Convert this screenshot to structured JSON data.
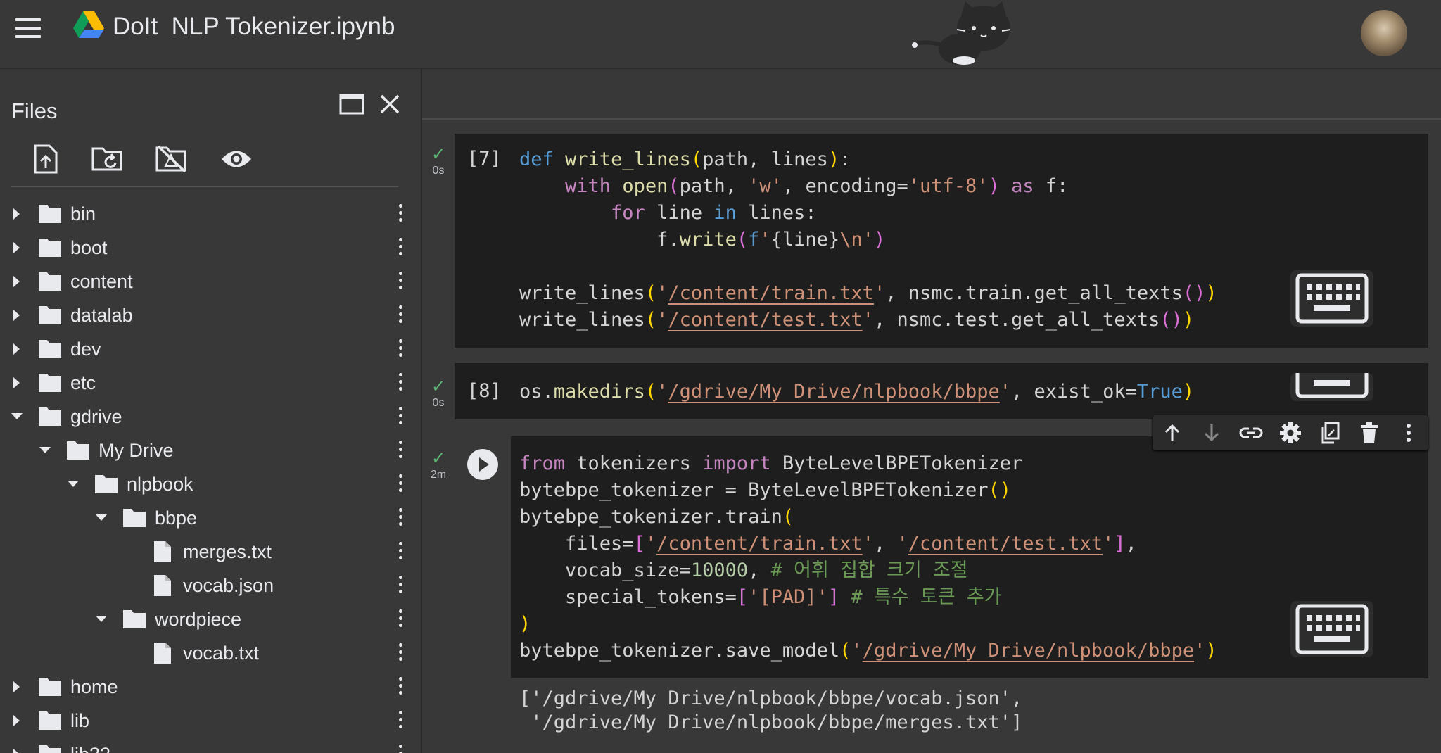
{
  "header": {
    "title": "DoIt  NLP Tokenizer.ipynb"
  },
  "sidebar": {
    "title": "Files",
    "items": [
      {
        "label": "bin",
        "type": "folder",
        "depth": 0,
        "expanded": false
      },
      {
        "label": "boot",
        "type": "folder",
        "depth": 0,
        "expanded": false
      },
      {
        "label": "content",
        "type": "folder",
        "depth": 0,
        "expanded": false
      },
      {
        "label": "datalab",
        "type": "folder",
        "depth": 0,
        "expanded": false
      },
      {
        "label": "dev",
        "type": "folder",
        "depth": 0,
        "expanded": false
      },
      {
        "label": "etc",
        "type": "folder",
        "depth": 0,
        "expanded": false
      },
      {
        "label": "gdrive",
        "type": "folder",
        "depth": 0,
        "expanded": true
      },
      {
        "label": "My Drive",
        "type": "folder",
        "depth": 1,
        "expanded": true
      },
      {
        "label": "nlpbook",
        "type": "folder",
        "depth": 2,
        "expanded": true
      },
      {
        "label": "bbpe",
        "type": "folder",
        "depth": 3,
        "expanded": true
      },
      {
        "label": "merges.txt",
        "type": "file",
        "depth": 4
      },
      {
        "label": "vocab.json",
        "type": "file",
        "depth": 4
      },
      {
        "label": "wordpiece",
        "type": "folder",
        "depth": 3,
        "expanded": true
      },
      {
        "label": "vocab.txt",
        "type": "file",
        "depth": 4
      },
      {
        "label": "home",
        "type": "folder",
        "depth": 0,
        "expanded": false
      },
      {
        "label": "lib",
        "type": "folder",
        "depth": 0,
        "expanded": false
      },
      {
        "label": "lib32",
        "type": "folder",
        "depth": 0,
        "expanded": false
      }
    ]
  },
  "cells": {
    "c7": {
      "prompt": "[7]",
      "time": "0s"
    },
    "c8": {
      "prompt": "[8]",
      "time": "0s"
    },
    "c9": {
      "time": "2m"
    }
  },
  "output": {
    "line1": "['/gdrive/My Drive/nlpbook/bbpe/vocab.json',",
    "line2": " '/gdrive/My Drive/nlpbook/bbpe/merges.txt']"
  },
  "icons": {
    "toolbar": [
      "upload-icon",
      "refresh-folder-icon",
      "hide-drive-icon",
      "eye-icon"
    ],
    "cell_toolbar": [
      "arrow-up-icon",
      "arrow-down-icon",
      "link-icon",
      "gear-icon",
      "mirror-cell-icon",
      "trash-icon",
      "more-vert-icon"
    ]
  },
  "colors": {
    "background": "#383838",
    "cell_background": "#1e1e1e",
    "keyword": "#c586c0",
    "string": "#ce9178",
    "function": "#dcdcaa",
    "number": "#b5cea8",
    "comment": "#6a9955",
    "check": "#5bb974"
  }
}
